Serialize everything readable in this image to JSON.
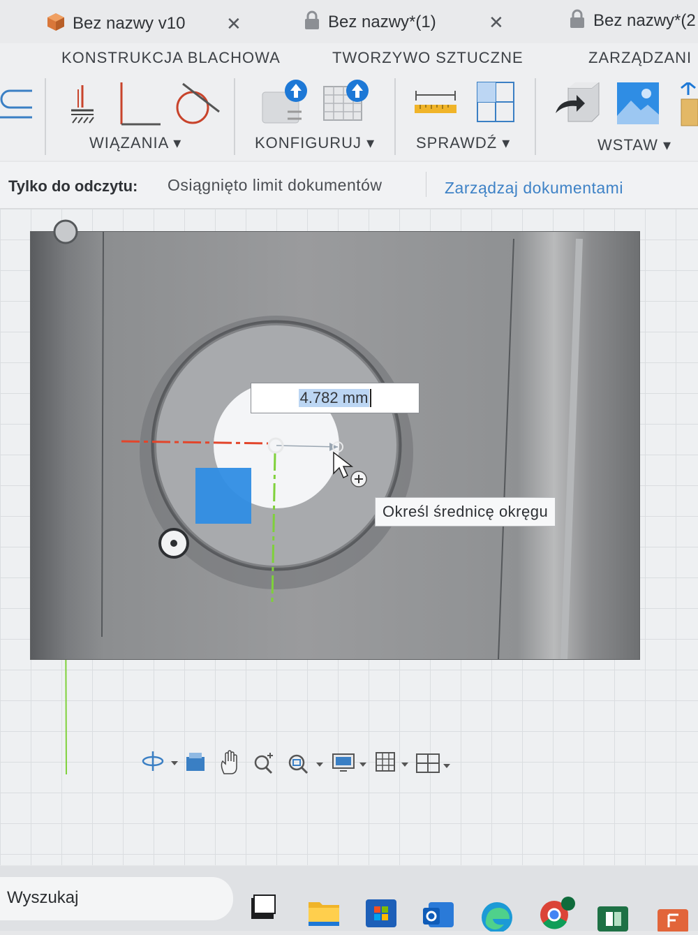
{
  "tabs": [
    {
      "label": "Bez nazwy v10",
      "icon": "box-icon",
      "closable": true,
      "active": true
    },
    {
      "label": "Bez nazwy*(1)",
      "icon": "lock-icon",
      "closable": true,
      "active": false
    },
    {
      "label": "Bez nazwy*(2",
      "icon": "lock-icon",
      "closable": false,
      "active": false
    }
  ],
  "workspace_tabs": [
    "KONSTRUKCJA BLACHOWA",
    "TWORZYWO SZTUCZNE",
    "ZARZĄDZANI"
  ],
  "ribbon": {
    "groups": [
      {
        "label": "WIĄZANIA ▾"
      },
      {
        "label": "KONFIGURUJ ▾"
      },
      {
        "label": "SPRAWDŹ ▾"
      },
      {
        "label": "WSTAW ▾"
      }
    ]
  },
  "readonly": {
    "label": "Tylko do odczytu:",
    "message": "Osiągnięto limit dokumentów",
    "link": "Zarządzaj dokumentami"
  },
  "sketch": {
    "dimension_value": "4.782 mm",
    "tooltip": "Określ średnicę okręgu"
  },
  "taskbar": {
    "search_placeholder": "Wyszukaj"
  },
  "colors": {
    "accent_blue": "#3e82c6",
    "axis_red": "#e2452b",
    "axis_green": "#7fd13b",
    "selection_blue": "#2f8de4"
  }
}
